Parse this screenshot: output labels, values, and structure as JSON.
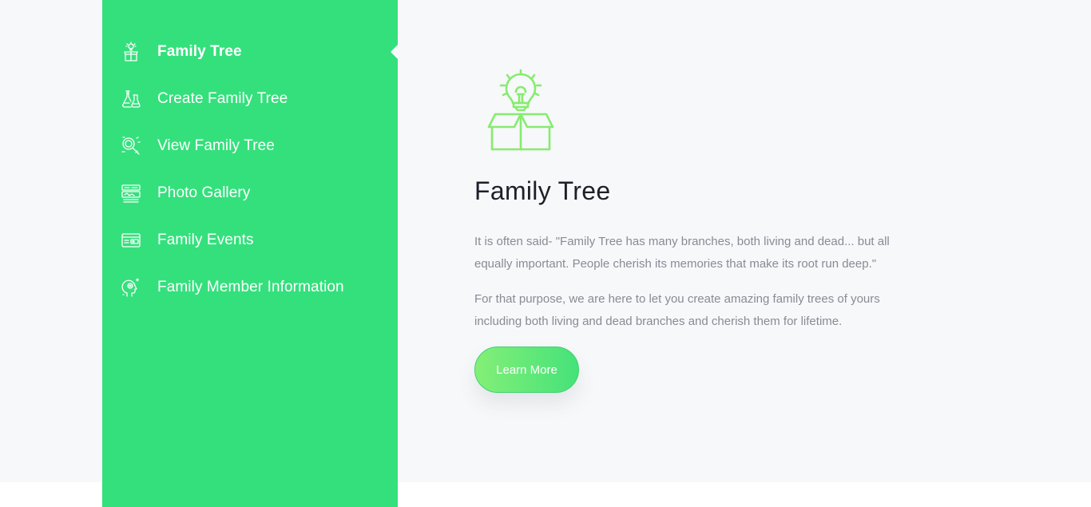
{
  "sidebar": {
    "items": [
      {
        "label": "Family Tree",
        "icon": "lightbulb-box-icon",
        "active": true
      },
      {
        "label": "Create Family Tree",
        "icon": "flask-icon",
        "active": false
      },
      {
        "label": "View Family Tree",
        "icon": "magnifier-icon",
        "active": false
      },
      {
        "label": "Photo Gallery",
        "icon": "gallery-icon",
        "active": false
      },
      {
        "label": "Family Events",
        "icon": "wallet-icon",
        "active": false
      },
      {
        "label": "Family Member Information",
        "icon": "head-gear-icon",
        "active": false
      }
    ]
  },
  "main": {
    "icon": "lightbulb-box-icon",
    "title": "Family Tree",
    "paragraph1": "It is often said- \"Family Tree has many branches, both living and dead... but all equally important. People cherish its memories that make its root run deep.\"",
    "paragraph2": "For that purpose, we are here to let you create amazing family trees of yours including both living and dead branches and cherish them for lifetime.",
    "button_label": "Learn More"
  },
  "colors": {
    "sidebar_bg": "#34e07c",
    "page_bg": "#f7f8fa",
    "accent_light": "#84ef77",
    "text_dark": "#1f1f2a",
    "text_muted": "#8a8a95"
  }
}
